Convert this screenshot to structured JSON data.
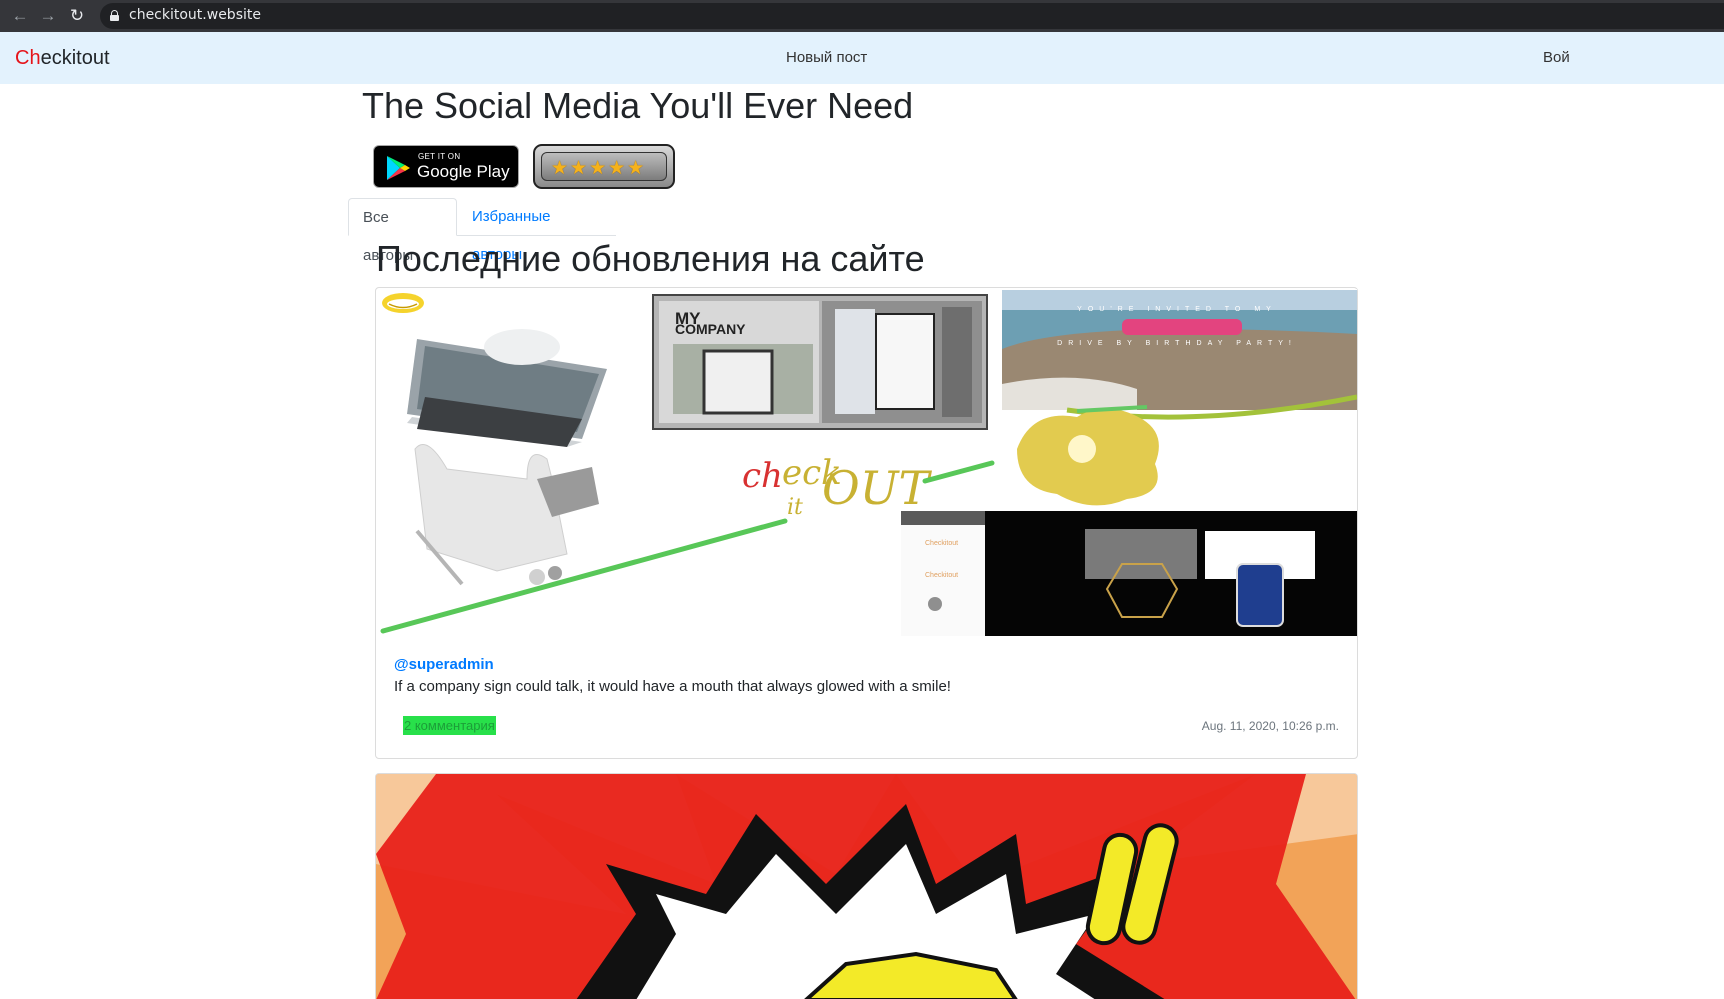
{
  "browser": {
    "url": "checkitout.website",
    "back_icon": "arrow-left-icon",
    "forward_icon": "arrow-right-icon",
    "reload_icon": "reload-icon"
  },
  "navbar": {
    "brand_accent": "Ch",
    "brand_rest": "eckitout",
    "new_post": "Новый пост",
    "login": "Вой"
  },
  "hero": {
    "title": "The Social Media You'll Ever Need",
    "gplay_small": "GET IT ON",
    "gplay_big": "Google Play",
    "rating_stars": "★★★★★"
  },
  "tabs": [
    {
      "label": "Все авторы",
      "active": true
    },
    {
      "label": "Избранные авторы",
      "active": false
    }
  ],
  "feed": {
    "title": "Последние обновления на сайте",
    "posts": [
      {
        "author": "@superadmin",
        "text": "If a company sign could talk, it would have a mouth that always glowed with a smile!",
        "comments": "2 комментария",
        "date": "Aug. 11, 2020, 10:26 p.m.",
        "image_caption_company": "MY COMPANY",
        "image_logo_text": "check it OUT",
        "invite_text": "YOU'RE INVITED TO MY DRIVE BY BIRTHDAY PARTY!"
      }
    ]
  },
  "colors": {
    "brand_accent": "#e5141a",
    "navbar_bg": "#e3f2fd",
    "link": "#007bff",
    "comments_badge": "#28e04a"
  }
}
